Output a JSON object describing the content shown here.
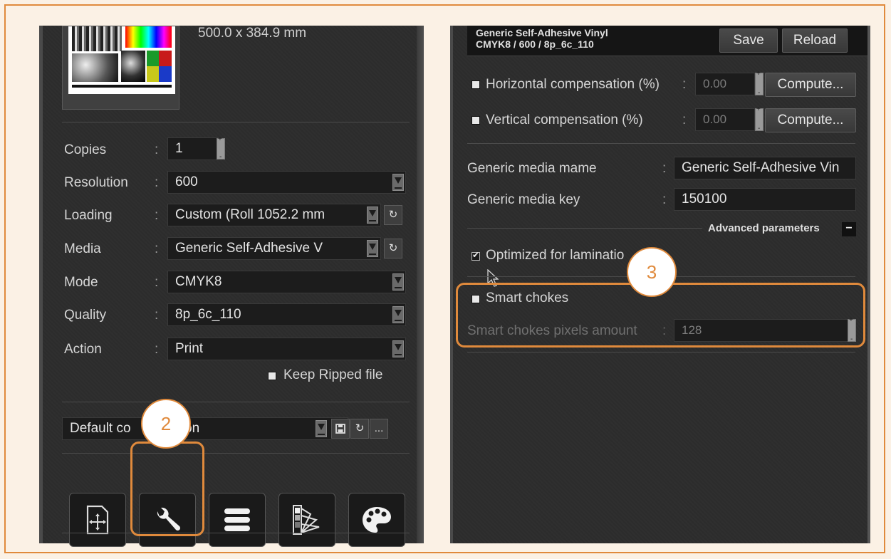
{
  "left": {
    "page_size": "500.0 x 384.9 mm",
    "copies_label": "Copies",
    "copies_value": "1",
    "resolution_label": "Resolution",
    "resolution_value": "600",
    "loading_label": "Loading",
    "loading_value": "Custom (Roll 1052.2 mm",
    "media_label": "Media",
    "media_value": "Generic Self-Adhesive V",
    "mode_label": "Mode",
    "mode_value": "CMYK8",
    "quality_label": "Quality",
    "quality_value": "8p_6c_110",
    "action_label": "Action",
    "action_value": "Print",
    "keep_ripped_label": "Keep Ripped file",
    "configuration_value_a": "Default co",
    "configuration_value_b": "tion",
    "more_label": "...",
    "colon": ":"
  },
  "right": {
    "header_line1": "Generic Self-Adhesive Vinyl",
    "header_line2": "CMYK8 / 600 / 8p_6c_110",
    "save_label": "Save",
    "reload_label": "Reload",
    "horiz_comp_label": "Horizontal compensation (%)",
    "horiz_comp_value": "0.00",
    "vert_comp_label": "Vertical compensation (%)",
    "vert_comp_value": "0.00",
    "compute_label": "Compute...",
    "generic_media_name_label": "Generic media mame",
    "generic_media_name_value": "Generic Self-Adhesive Vin",
    "generic_media_key_label": "Generic media key",
    "generic_media_key_value": "150100",
    "advanced_label": "Advanced parameters",
    "advanced_toggle": "−",
    "optimized_lamination_label": "Optimized for laminatio",
    "smart_chokes_label": "Smart chokes",
    "smart_chokes_pixels_label": "Smart chokes pixels amount",
    "smart_chokes_pixels_value": "128",
    "colon": ":"
  },
  "callouts": {
    "two": "2",
    "three": "3"
  },
  "colors": {
    "accent": "#e08a3c",
    "panel": "#2d2d2d",
    "field": "#1c1c1c"
  },
  "icons": [
    "move-file-icon",
    "wrench-icon",
    "list-icon",
    "color-swatch-icon",
    "palette-icon",
    "save-icon",
    "refresh-icon",
    "cursor-icon"
  ]
}
